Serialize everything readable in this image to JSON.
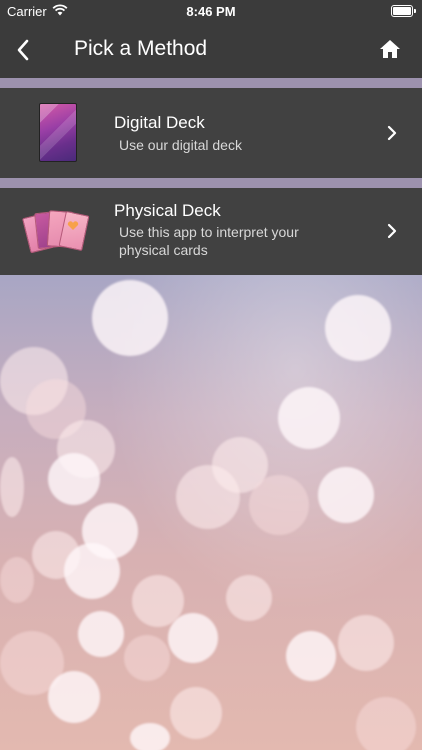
{
  "status": {
    "carrier": "Carrier",
    "time": "8:46 PM"
  },
  "nav": {
    "title": "Pick a Method",
    "back_icon": "chevron-left-icon",
    "home_icon": "home-icon"
  },
  "methods": [
    {
      "title": "Digital Deck",
      "subtitle": "Use our digital deck",
      "icon": "digital-deck-thumbnail"
    },
    {
      "title": "Physical Deck",
      "subtitle_line1": "Use this app to interpret your",
      "subtitle_line2": "physical cards",
      "icon": "physical-cards-thumbnail"
    }
  ],
  "colors": {
    "bar": "#3b3b3b",
    "row": "#414141",
    "divider": "#9d92ae"
  }
}
